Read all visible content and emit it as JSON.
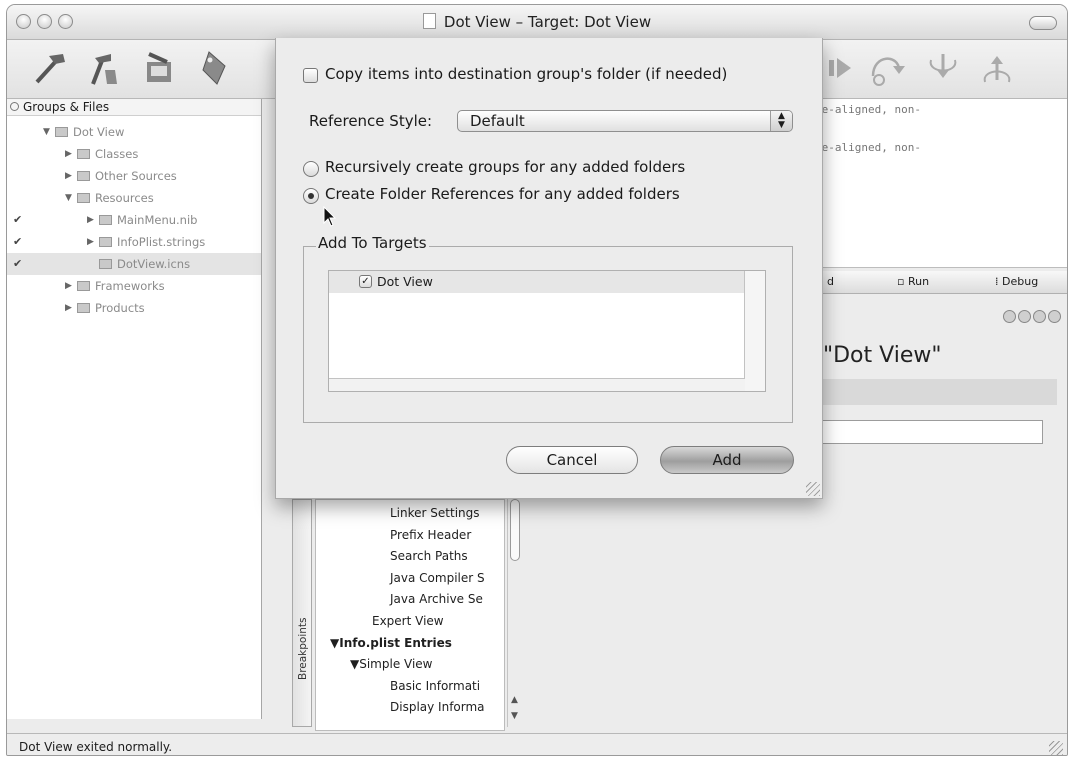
{
  "window": {
    "title": "Dot View – Target: Dot View"
  },
  "toolbar": {
    "icons": [
      "build-hammer-icon",
      "clean-broom-hammer-icon",
      "build-and-run-icon",
      "tag-icon",
      "continue-icon",
      "step-over-icon",
      "step-into-icon",
      "step-out-icon"
    ]
  },
  "groups": {
    "header": "Groups & Files",
    "items": [
      {
        "label": "Dot View",
        "level": 0,
        "expanded": true,
        "checked": false
      },
      {
        "label": "Classes",
        "level": 1,
        "expanded": false,
        "checked": false
      },
      {
        "label": "Other Sources",
        "level": 1,
        "expanded": false,
        "checked": false
      },
      {
        "label": "Resources",
        "level": 1,
        "expanded": true,
        "checked": false
      },
      {
        "label": "MainMenu.nib",
        "level": 2,
        "expanded": false,
        "checked": true
      },
      {
        "label": "InfoPlist.strings",
        "level": 2,
        "expanded": false,
        "checked": true
      },
      {
        "label": "DotView.icns",
        "level": 2,
        "expanded": false,
        "checked": true,
        "selected": true
      },
      {
        "label": "Frameworks",
        "level": 1,
        "expanded": false,
        "checked": false
      },
      {
        "label": "Products",
        "level": 1,
        "expanded": false,
        "checked": false
      }
    ]
  },
  "editor": {
    "lines": [
      "ge-aligned, non-",
      "ge-aligned, non-"
    ]
  },
  "build_tabs": [
    "d",
    "Run",
    "Debug"
  ],
  "target_heading": "\"Dot View\"",
  "settings_list": [
    {
      "label": "Linker Settings",
      "bold": false
    },
    {
      "label": "Prefix Header",
      "bold": false
    },
    {
      "label": "Search Paths",
      "bold": false
    },
    {
      "label": "Java Compiler S",
      "bold": false
    },
    {
      "label": "Java Archive Se",
      "bold": false
    },
    {
      "label": "Expert View",
      "bold": false
    },
    {
      "label": "▼Info.plist Entries",
      "bold": true
    },
    {
      "label": "▼Simple View",
      "bold": false
    },
    {
      "label": "Basic Informati",
      "bold": false
    },
    {
      "label": "Display Informa",
      "bold": false
    }
  ],
  "side_tab": "Breakpoints",
  "status": "Dot View exited normally.",
  "sheet": {
    "copy_label": "Copy items into destination group's folder (if needed)",
    "reference_style_label": "Reference Style:",
    "reference_style_value": "Default",
    "radio_recursive": "Recursively create groups for any added folders",
    "radio_folder_refs": "Create Folder References for any added folders",
    "add_to_targets": "Add To Targets",
    "target_item": "Dot View",
    "cancel": "Cancel",
    "add": "Add"
  }
}
